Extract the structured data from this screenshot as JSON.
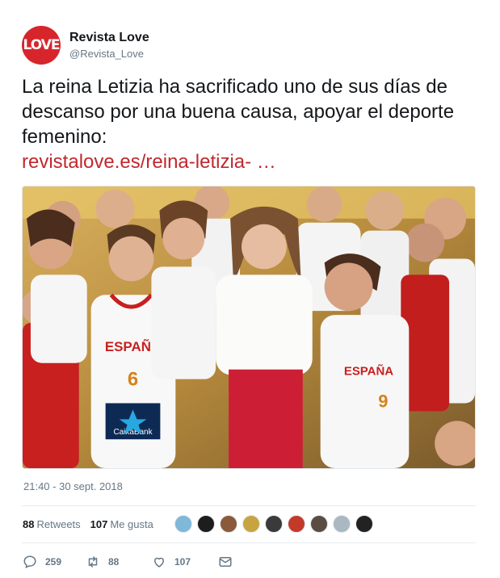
{
  "author": {
    "avatar_text": "LOVE",
    "display_name": "Revista Love",
    "handle": "@Revista_Love",
    "brand_color": "#d7252c"
  },
  "tweet": {
    "text": "La reina Letizia ha sacrificado uno de sus días de descanso por una buena causa, apoyar el deporte femenino:",
    "link": "revistalove.es/reina-letizia- …",
    "link_color": "#c0282e"
  },
  "media": {
    "jersey_text": "ESPAÑA",
    "numbers": [
      "6",
      "9"
    ],
    "sponsor": "CaixaBank"
  },
  "timestamp": "21:40 - 30 sept. 2018",
  "stats": {
    "retweets_count": "88",
    "retweets_label": "Retweets",
    "likes_count": "107",
    "likes_label": "Me gusta"
  },
  "likers": {
    "colors": [
      "#7fb8d8",
      "#1d1d1d",
      "#8a5a3a",
      "#c8a440",
      "#3a3a3a",
      "#c43a2a",
      "#5b4c42",
      "#aab8c2",
      "#222222"
    ]
  },
  "actions": {
    "reply_count": "259",
    "retweet_count": "88",
    "like_count": "107",
    "icons": [
      "reply-icon",
      "retweet-icon",
      "like-icon",
      "message-icon"
    ]
  }
}
